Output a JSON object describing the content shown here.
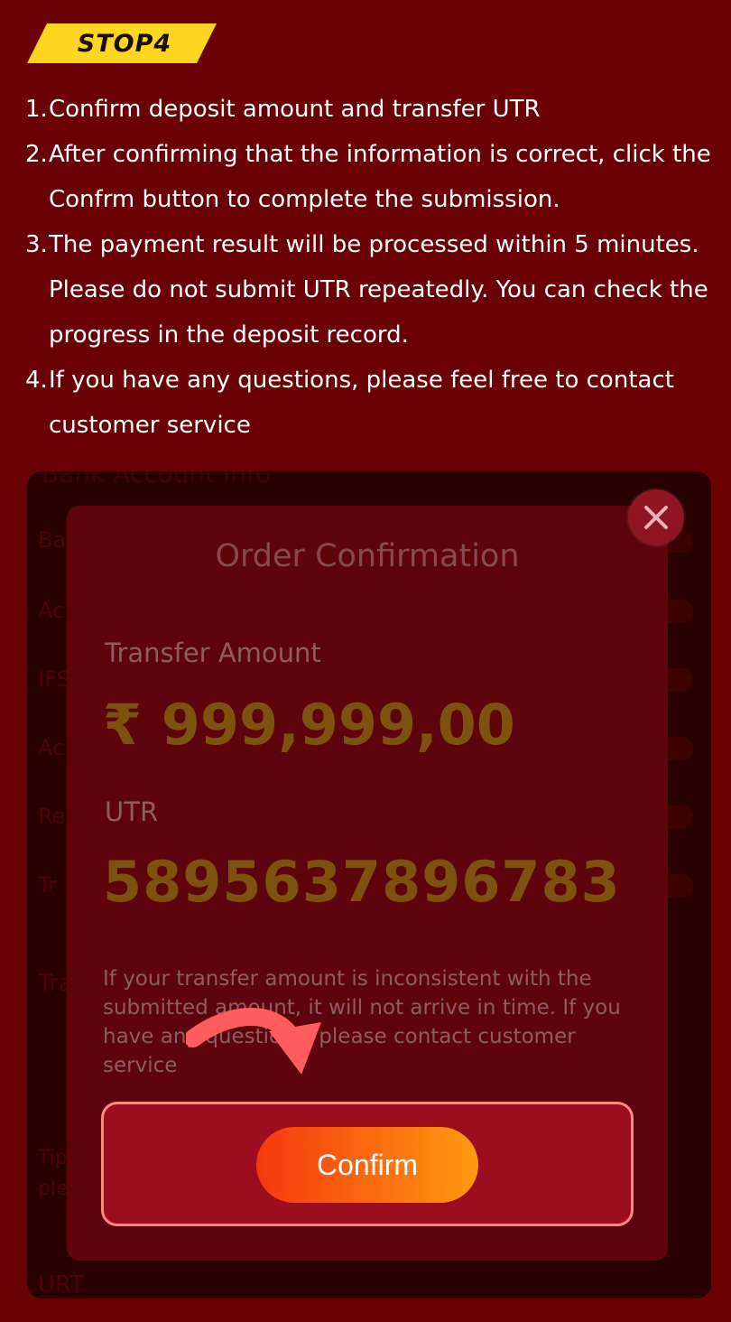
{
  "step": {
    "tag": "STOP4"
  },
  "instructions": [
    {
      "num": "1.",
      "text": "Confirm deposit amount and transfer UTR"
    },
    {
      "num": "2.",
      "text": "After confirming that the information is correct, click the Confrm button to complete the submission."
    },
    {
      "num": "3.",
      "text": "The payment result will be processed within 5 minutes. Please do not submit UTR repeatedly. You can check the progress in the deposit record."
    },
    {
      "num": "4.",
      "text": "If you have any questions, please feel free to contact customer service"
    }
  ],
  "bank_panel": {
    "title": "Bank Account Info",
    "rows": [
      "Ba",
      "Ac",
      "IFS",
      "Ac",
      "Re",
      "Tr"
    ],
    "field_label": "Tra",
    "tip_line1": "Tip",
    "tip_line2": "ple",
    "footer": "URT"
  },
  "modal": {
    "title": "Order Confirmation",
    "amount_label": "Transfer Amount",
    "amount": "₹ 999,999,00",
    "utr_label": "UTR",
    "utr": "5895637896783",
    "notice": "If your transfer amount is inconsistent with the submitted amount, it will not arrive in time. If you have any questions, please contact customer service",
    "confirm_label": "Confirm",
    "close_icon": "close-icon"
  },
  "colors": {
    "background": "#6a0205",
    "tag": "#ffd61f",
    "modal": "#5e040c",
    "amount_text": "#7c520e",
    "confirm_gradient_start": "#f5380e",
    "confirm_gradient_end": "#ff9a10",
    "highlight_border": "#ff8a82"
  }
}
